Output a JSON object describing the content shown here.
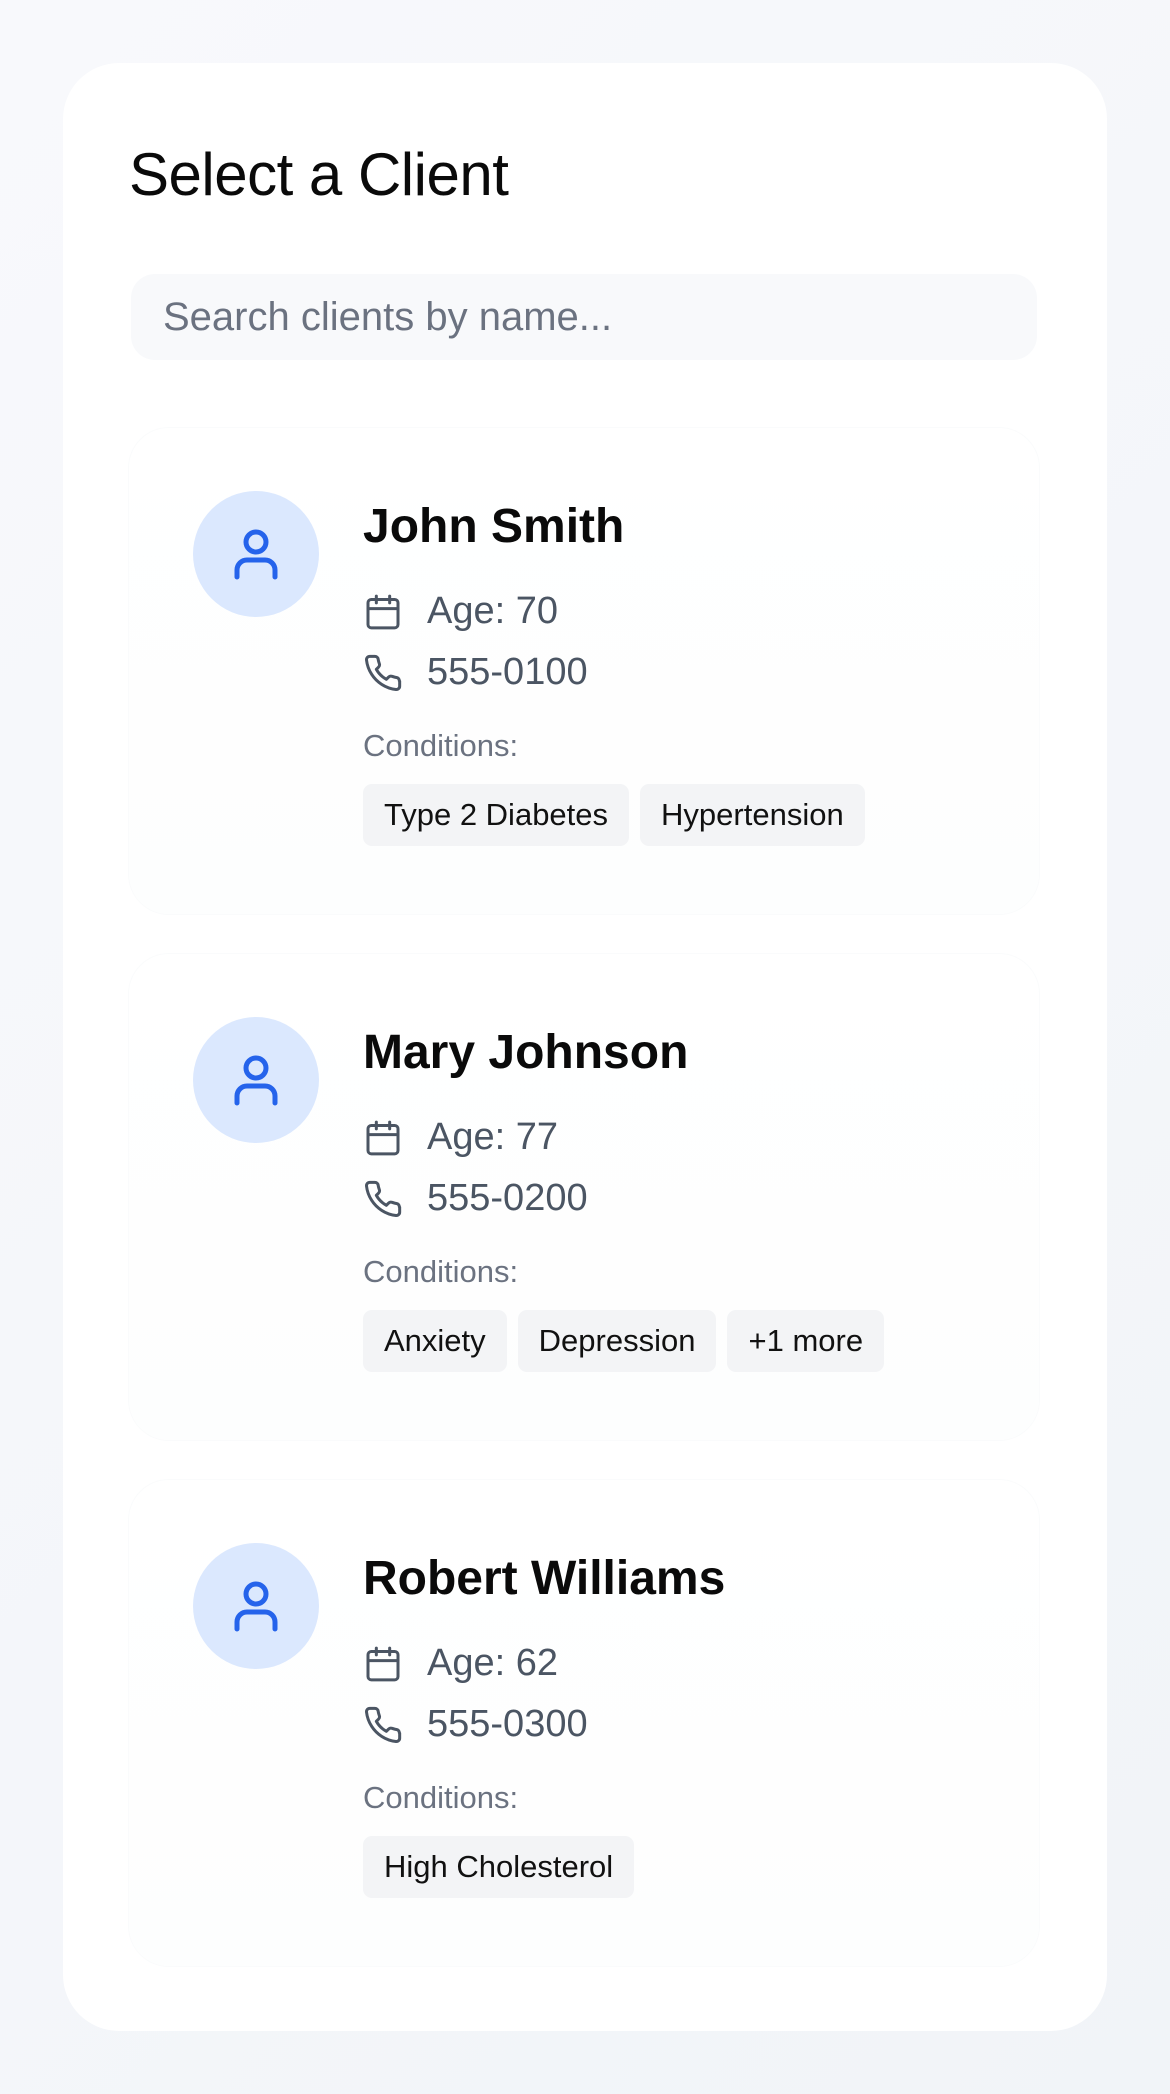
{
  "page": {
    "title": "Select a Client"
  },
  "search": {
    "placeholder": "Search clients by name...",
    "value": ""
  },
  "labels": {
    "conditions": "Conditions:"
  },
  "colors": {
    "accent": "#2563eb",
    "avatar_bg": "#dbe8fe",
    "tag_bg": "#f3f4f6",
    "muted_text": "#6b7280"
  },
  "icons": {
    "avatar": "user-icon",
    "age": "calendar-icon",
    "phone": "phone-icon"
  },
  "clients": [
    {
      "name": "John Smith",
      "age": "Age: 70",
      "phone": "555-0100",
      "conditions": [
        "Type 2 Diabetes",
        "Hypertension"
      ]
    },
    {
      "name": "Mary Johnson",
      "age": "Age: 77",
      "phone": "555-0200",
      "conditions": [
        "Anxiety",
        "Depression",
        "+1 more"
      ]
    },
    {
      "name": "Robert Williams",
      "age": "Age: 62",
      "phone": "555-0300",
      "conditions": [
        "High Cholesterol"
      ]
    }
  ]
}
